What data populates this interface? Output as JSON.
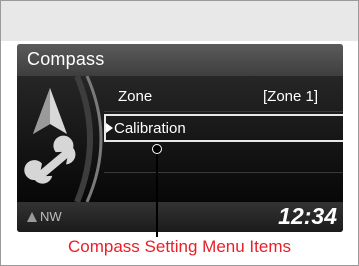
{
  "screen": {
    "title": "Compass",
    "menu": {
      "zone_label": "Zone",
      "zone_value": "[Zone 1]",
      "calibration_label": "Calibration"
    },
    "status": {
      "heading": "NW",
      "time": "12:34"
    },
    "icons": [
      "compass-arrow-icon",
      "wrench-icon",
      "heading-arrow-icon"
    ]
  },
  "annotation": {
    "caption": "Compass Setting Menu Items"
  },
  "colors": {
    "caption": "#e8202a",
    "display_bg": "#111111",
    "highlight_border": "#e9e9e9"
  }
}
